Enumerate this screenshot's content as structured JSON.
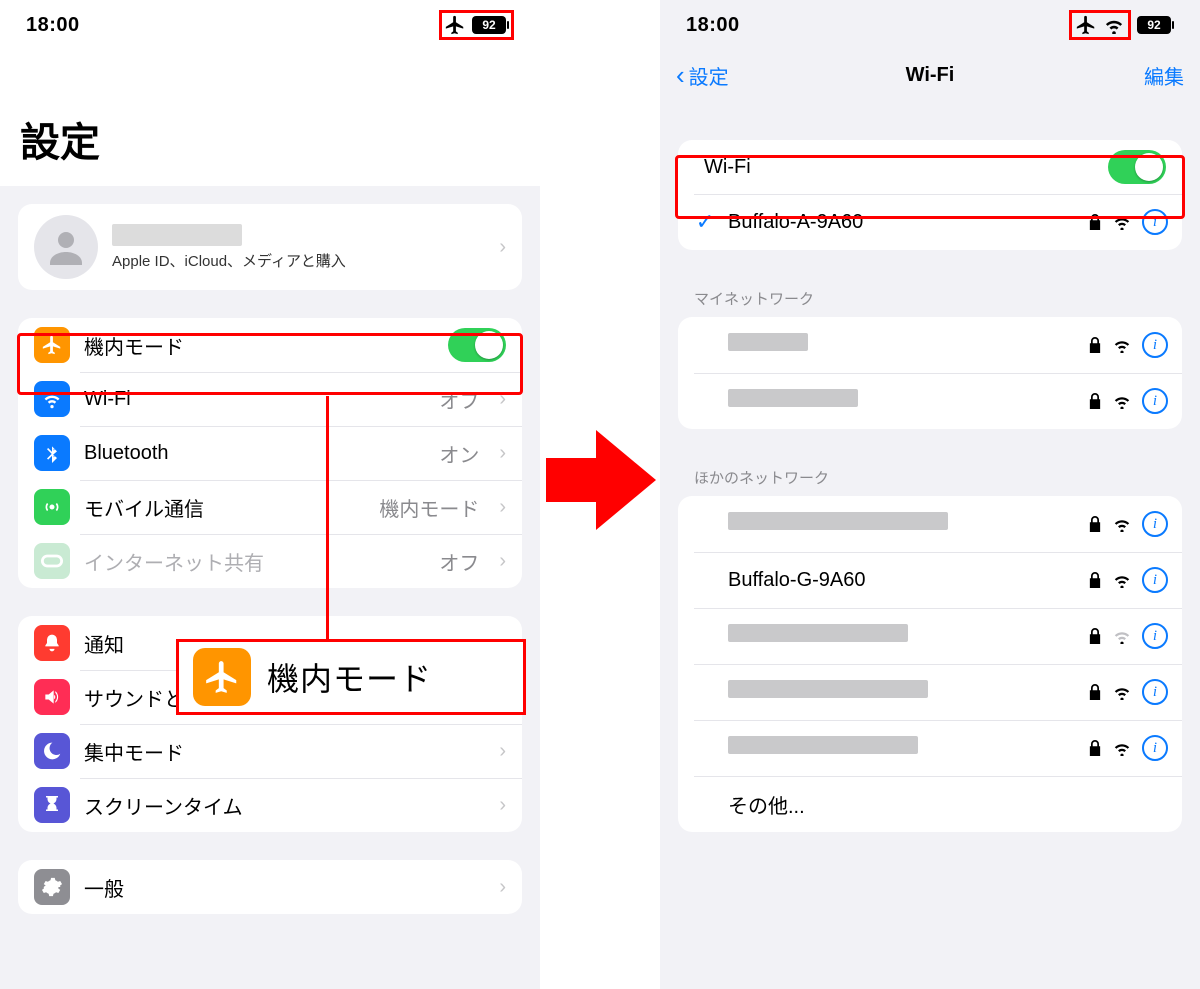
{
  "left": {
    "time": "18:00",
    "battery": "92",
    "title": "設定",
    "apple_sub": "Apple ID、iCloud、メディアと購入",
    "rows_net": {
      "airplane": "機内モード",
      "wifi": "Wi-Fi",
      "wifi_val": "オフ",
      "bt": "Bluetooth",
      "bt_val": "オン",
      "cell": "モバイル通信",
      "cell_val": "機内モード",
      "hotspot": "インターネット共有",
      "hotspot_val": "オフ"
    },
    "rows_sys": {
      "notify": "通知",
      "sound": "サウンドと触覚",
      "focus": "集中モード",
      "screentime": "スクリーンタイム"
    },
    "rows_gen": {
      "general": "一般"
    },
    "callout": "機内モード"
  },
  "right": {
    "time": "18:00",
    "battery": "92",
    "back": "設定",
    "title": "Wi-Fi",
    "edit": "編集",
    "wifi_label": "Wi-Fi",
    "connected": "Buffalo-A-9A60",
    "sec_my": "マイネットワーク",
    "sec_other": "ほかのネットワーク",
    "other_item": "その他...",
    "known_nw2": "Buffalo-G-9A60"
  }
}
